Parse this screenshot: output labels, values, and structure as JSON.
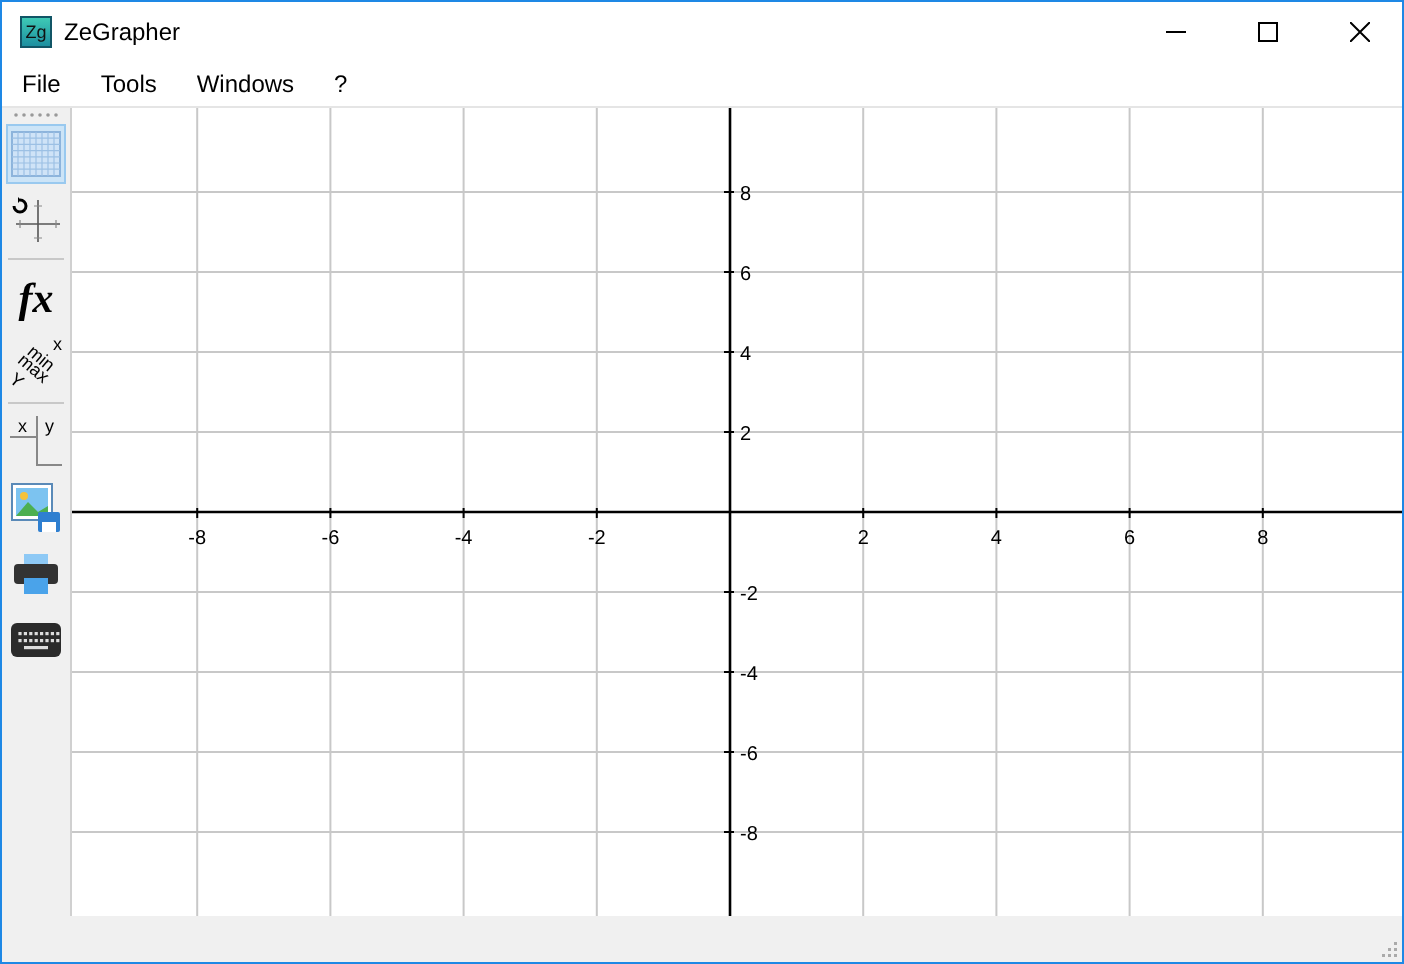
{
  "window": {
    "app_icon": "Zg",
    "title": "ZeGrapher"
  },
  "menu": [
    {
      "label": "File"
    },
    {
      "label": "Tools"
    },
    {
      "label": "Windows"
    },
    {
      "label": "?"
    }
  ],
  "toolbar": [
    {
      "kind": "grid",
      "selected": true
    },
    {
      "kind": "axes",
      "selected": false
    },
    {
      "kind": "text",
      "label": "fx",
      "selected": false
    },
    {
      "kind": "bounds",
      "labels": [
        "x",
        "min",
        "max",
        "Y"
      ],
      "selected": false
    },
    {
      "kind": "table",
      "labels": [
        "x",
        "y"
      ],
      "selected": false
    },
    {
      "kind": "image",
      "selected": false
    },
    {
      "kind": "printer",
      "selected": false
    },
    {
      "kind": "keyboard",
      "selected": false
    }
  ],
  "graph": {
    "chart_data": {
      "type": "line",
      "grid": true,
      "xlim": [
        -9.88,
        10.12
      ],
      "ylim": [
        -10.15,
        10.1
      ],
      "xticks": [
        -8,
        -6,
        -4,
        -2,
        2,
        4,
        6,
        8
      ],
      "yticks": [
        -8,
        -6,
        -4,
        -2,
        2,
        4,
        6,
        8
      ]
    }
  }
}
